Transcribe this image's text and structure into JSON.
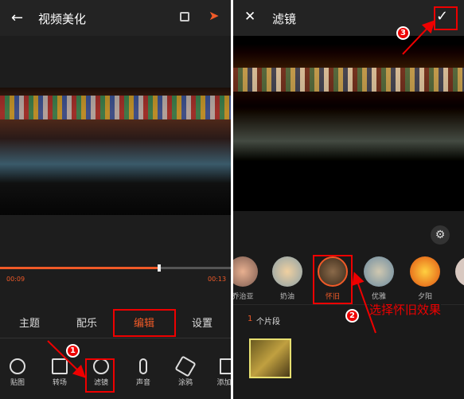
{
  "left": {
    "title": "视频美化",
    "time_current": "00:09",
    "time_total": "00:13",
    "progress": 0.69,
    "tabs": [
      {
        "label": "主题"
      },
      {
        "label": "配乐"
      },
      {
        "label": "编辑",
        "active": true
      },
      {
        "label": "设置"
      }
    ],
    "tools": [
      {
        "label": "贴图",
        "icon": "sticker-icon"
      },
      {
        "label": "转场",
        "icon": "transition-icon"
      },
      {
        "label": "滤镜",
        "icon": "filter-icon"
      },
      {
        "label": "声音",
        "icon": "microphone-icon"
      },
      {
        "label": "涂鸦",
        "icon": "brush-icon"
      },
      {
        "label": "添加片",
        "icon": "add-clip-icon"
      }
    ]
  },
  "right": {
    "title": "滤镜",
    "filters": [
      {
        "label": "乔治亚"
      },
      {
        "label": "奶油"
      },
      {
        "label": "怀旧",
        "selected": true
      },
      {
        "label": "优雅"
      },
      {
        "label": "夕阳"
      }
    ],
    "clip_count": "1",
    "clip_label": "个片段"
  },
  "annotations": {
    "step1": "1",
    "step2": "2",
    "step3": "3",
    "note": "选择怀旧效果"
  },
  "colors": {
    "accent": "#f05a28",
    "annotation": "#e00000"
  }
}
